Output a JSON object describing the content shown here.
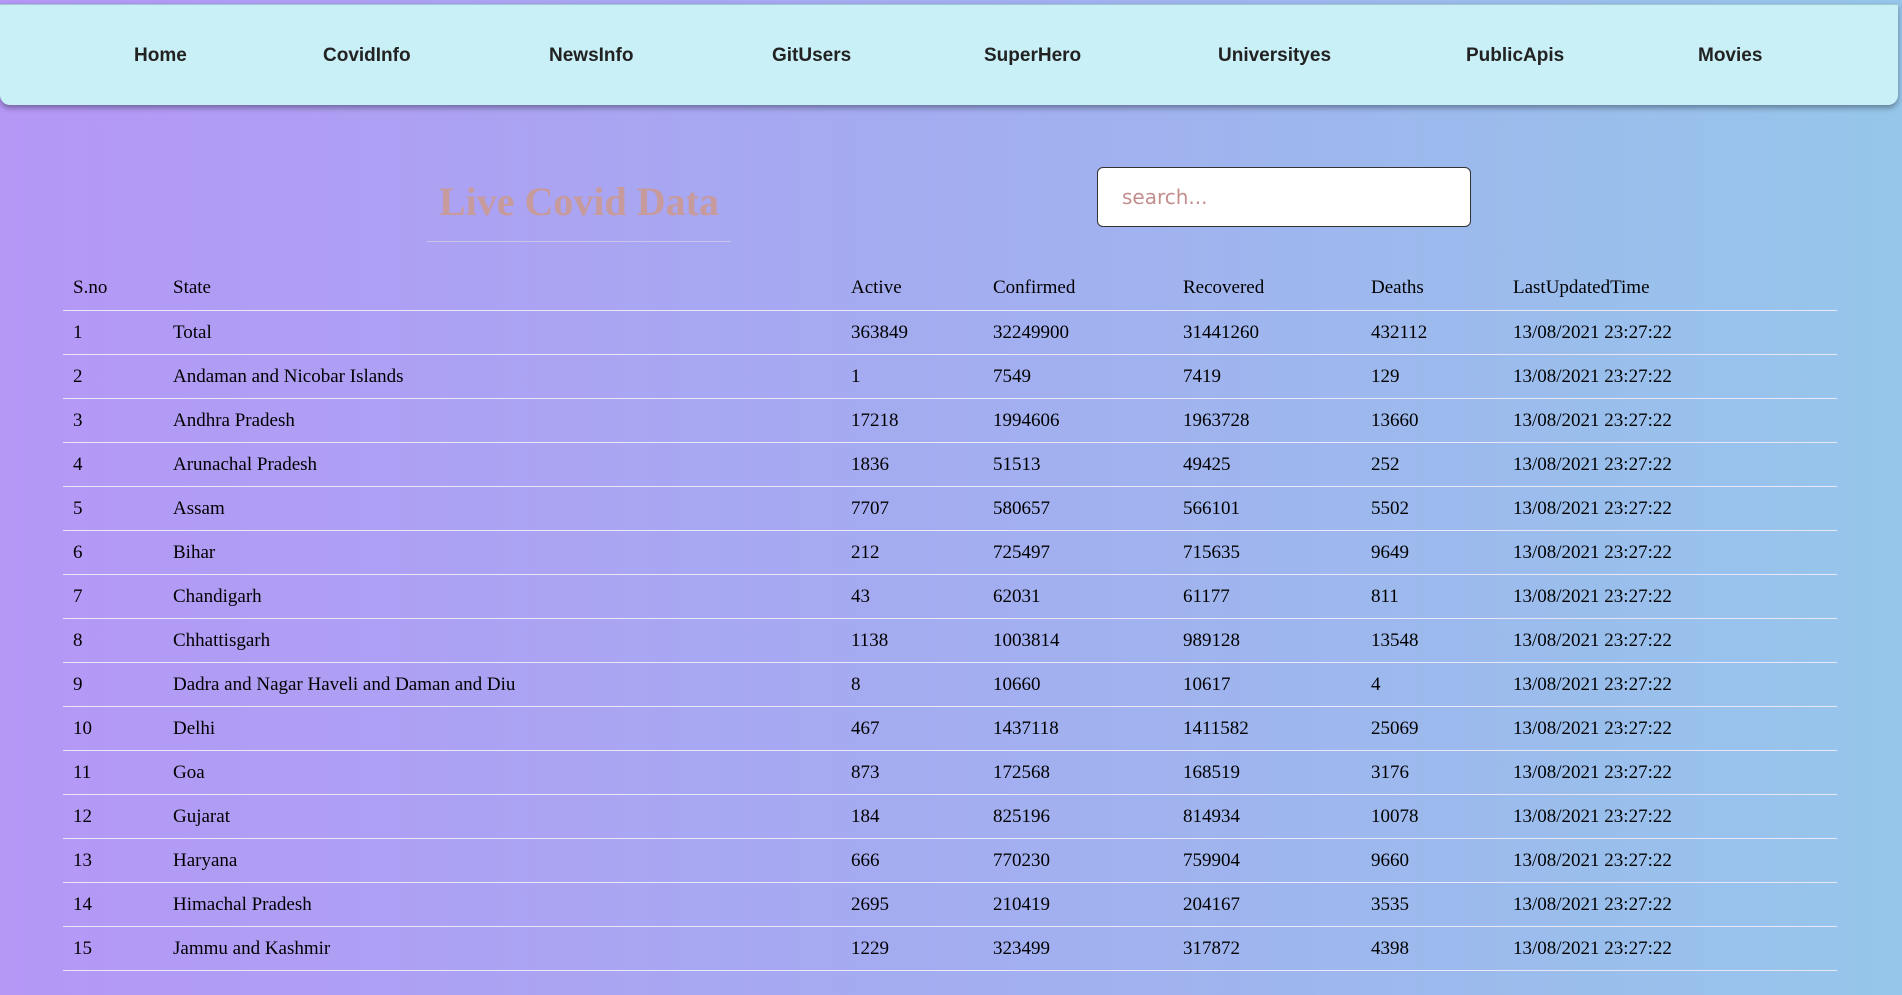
{
  "nav": {
    "items": [
      {
        "label": "Home"
      },
      {
        "label": "CovidInfo"
      },
      {
        "label": "NewsInfo"
      },
      {
        "label": "GitUsers"
      },
      {
        "label": "SuperHero"
      },
      {
        "label": "Universityes"
      },
      {
        "label": "PublicApis"
      },
      {
        "label": "Movies"
      }
    ]
  },
  "page": {
    "title": "Live Covid Data"
  },
  "search": {
    "placeholder": "search...",
    "value": ""
  },
  "colors": {
    "nav_background": "#c8f0f6",
    "title": "#c79a9c",
    "gradient_start": "#b597f6",
    "gradient_end": "#96c6ea"
  },
  "table": {
    "headers": [
      "S.no",
      "State",
      "Active",
      "Confirmed",
      "Recovered",
      "Deaths",
      "LastUpdatedTime"
    ],
    "rows": [
      [
        "1",
        "Total",
        "363849",
        "32249900",
        "31441260",
        "432112",
        "13/08/2021 23:27:22"
      ],
      [
        "2",
        "Andaman and Nicobar Islands",
        "1",
        "7549",
        "7419",
        "129",
        "13/08/2021 23:27:22"
      ],
      [
        "3",
        "Andhra Pradesh",
        "17218",
        "1994606",
        "1963728",
        "13660",
        "13/08/2021 23:27:22"
      ],
      [
        "4",
        "Arunachal Pradesh",
        "1836",
        "51513",
        "49425",
        "252",
        "13/08/2021 23:27:22"
      ],
      [
        "5",
        "Assam",
        "7707",
        "580657",
        "566101",
        "5502",
        "13/08/2021 23:27:22"
      ],
      [
        "6",
        "Bihar",
        "212",
        "725497",
        "715635",
        "9649",
        "13/08/2021 23:27:22"
      ],
      [
        "7",
        "Chandigarh",
        "43",
        "62031",
        "61177",
        "811",
        "13/08/2021 23:27:22"
      ],
      [
        "8",
        "Chhattisgarh",
        "1138",
        "1003814",
        "989128",
        "13548",
        "13/08/2021 23:27:22"
      ],
      [
        "9",
        "Dadra and Nagar Haveli and Daman and Diu",
        "8",
        "10660",
        "10617",
        "4",
        "13/08/2021 23:27:22"
      ],
      [
        "10",
        "Delhi",
        "467",
        "1437118",
        "1411582",
        "25069",
        "13/08/2021 23:27:22"
      ],
      [
        "11",
        "Goa",
        "873",
        "172568",
        "168519",
        "3176",
        "13/08/2021 23:27:22"
      ],
      [
        "12",
        "Gujarat",
        "184",
        "825196",
        "814934",
        "10078",
        "13/08/2021 23:27:22"
      ],
      [
        "13",
        "Haryana",
        "666",
        "770230",
        "759904",
        "9660",
        "13/08/2021 23:27:22"
      ],
      [
        "14",
        "Himachal Pradesh",
        "2695",
        "210419",
        "204167",
        "3535",
        "13/08/2021 23:27:22"
      ],
      [
        "15",
        "Jammu and Kashmir",
        "1229",
        "323499",
        "317872",
        "4398",
        "13/08/2021 23:27:22"
      ]
    ]
  }
}
